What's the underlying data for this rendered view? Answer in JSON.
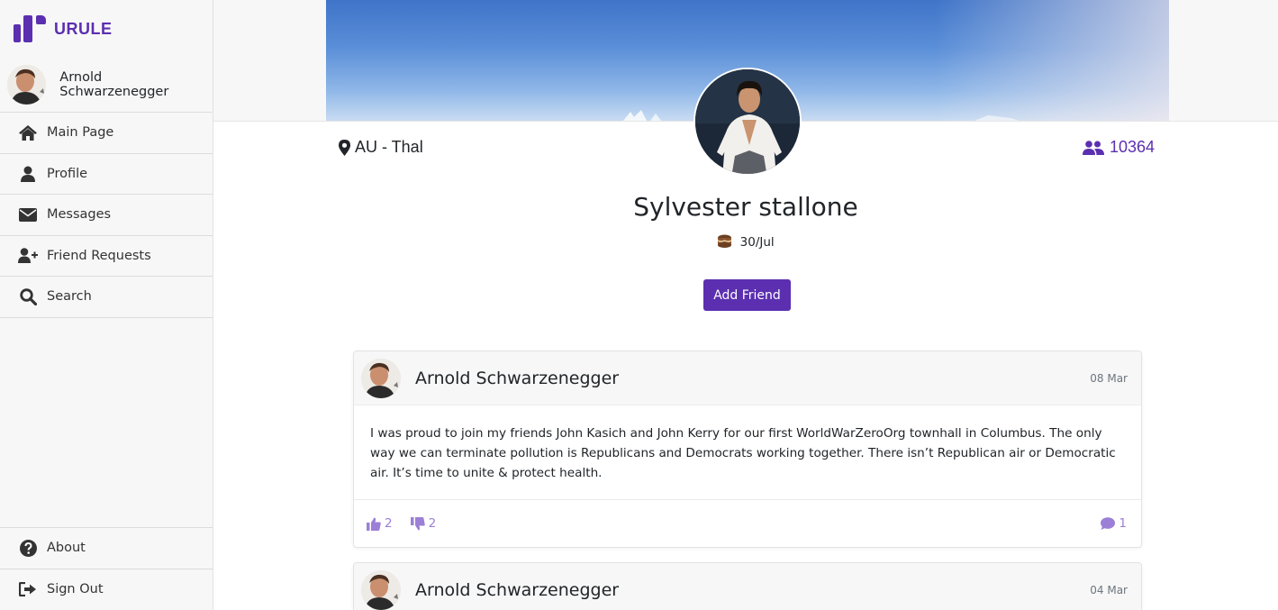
{
  "brand": {
    "name": "URULE",
    "color": "#5b2fb0"
  },
  "current_user": {
    "name": "Arnold Schwarzenegger"
  },
  "sidebar": {
    "items": [
      {
        "label": "Main Page",
        "icon": "home-icon"
      },
      {
        "label": "Profile",
        "icon": "user-icon"
      },
      {
        "label": "Messages",
        "icon": "envelope-icon"
      },
      {
        "label": "Friend Requests",
        "icon": "user-plus-icon"
      },
      {
        "label": "Search",
        "icon": "search-icon"
      }
    ],
    "bottom_items": [
      {
        "label": "About",
        "icon": "question-circle-icon"
      },
      {
        "label": "Sign Out",
        "icon": "sign-out-icon"
      }
    ]
  },
  "profile": {
    "name": "Sylvester stallone",
    "location": "AU - Thal",
    "friends_count": "10364",
    "birthday": "30/Jul",
    "add_friend_label": "Add Friend"
  },
  "posts": [
    {
      "author": "Arnold Schwarzenegger",
      "date": "08 Mar",
      "text": "I was proud to join my friends John Kasich and John Kerry for our first WorldWarZeroOrg townhall in Columbus. The only way we can terminate pollution is Republicans and Democrats working together. There isn’t Republican air or Democratic air. It’s time to unite & protect health.",
      "likes": "2",
      "dislikes": "2",
      "comments": "1"
    },
    {
      "author": "Arnold Schwarzenegger",
      "date": "04 Mar"
    }
  ]
}
